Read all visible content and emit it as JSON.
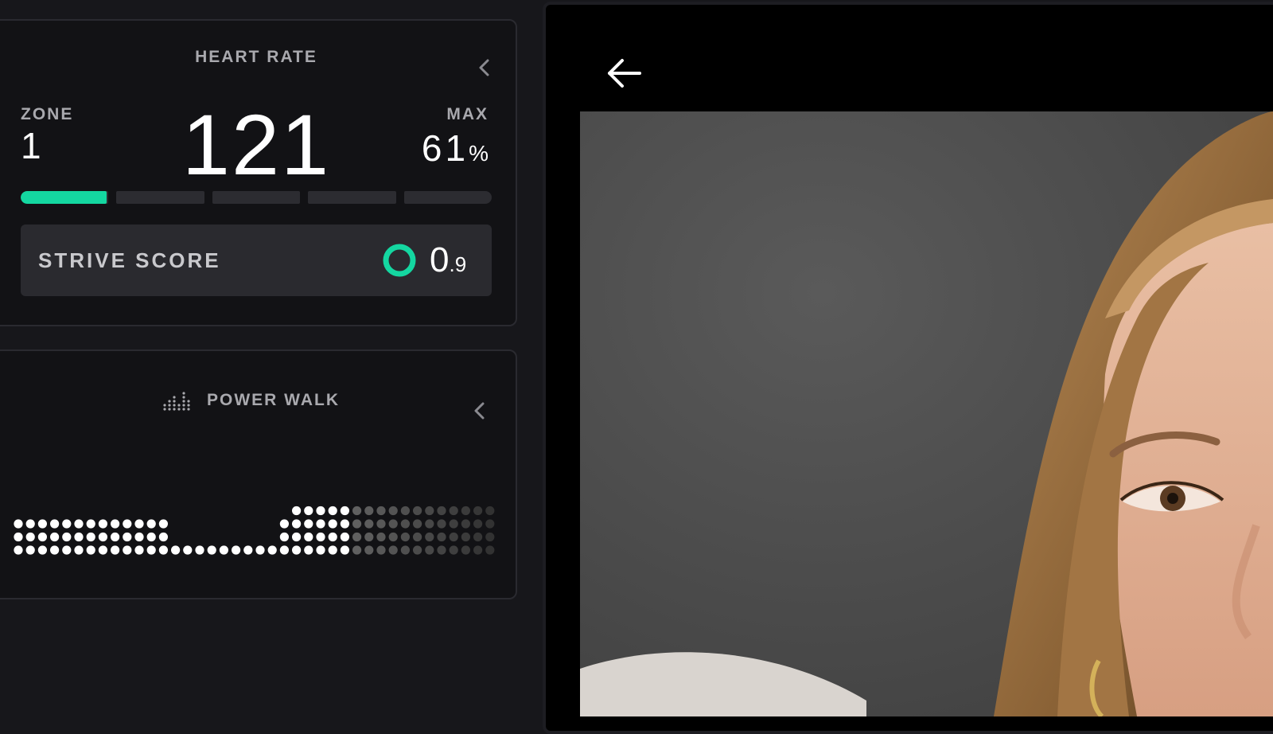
{
  "heart_rate_panel": {
    "title": "HEART RATE",
    "zone_label": "ZONE",
    "zone_value": "1",
    "max_label": "MAX",
    "max_value": "61",
    "max_unit": "%",
    "bpm": "121",
    "zone_progress": {
      "segments": 5,
      "active_segment_fill": 0.98
    },
    "accent_color": "#14d7a1",
    "strive": {
      "label": "STRIVE SCORE",
      "value_int": "0",
      "value_dec": ".9"
    }
  },
  "workout_panel": {
    "title": "POWER WALK",
    "icon": "equalizer-dots-icon",
    "progress_fraction": 0.71
  },
  "video": {
    "back_icon": "arrow-left-icon"
  }
}
